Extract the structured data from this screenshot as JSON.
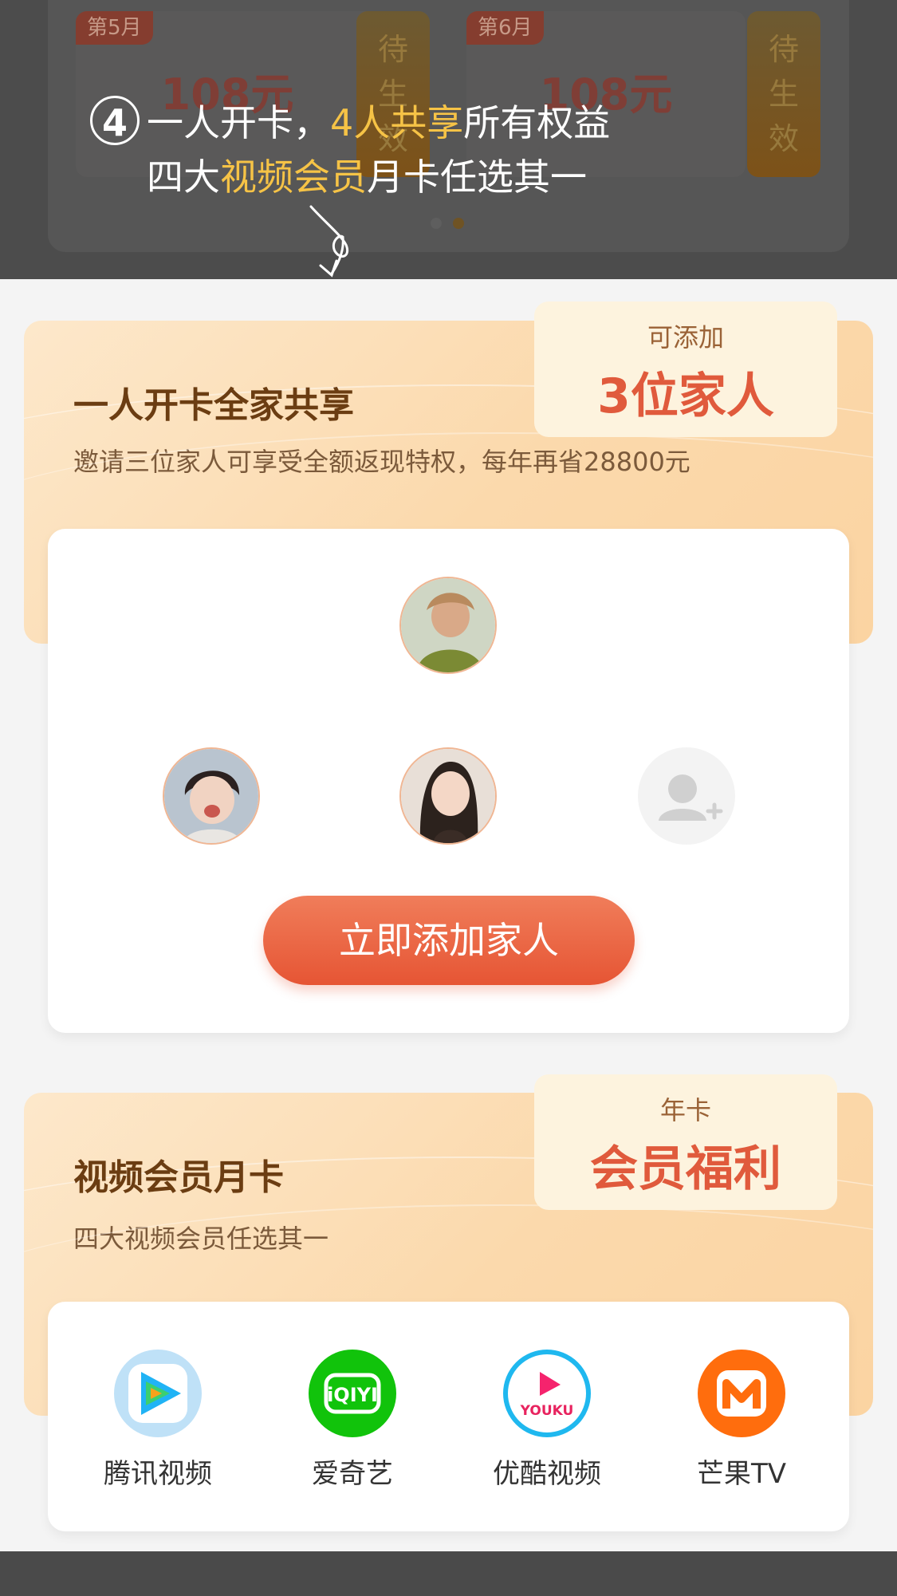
{
  "tip": {
    "number": "4",
    "line1_a": "一人开卡，",
    "line1_hl": "4人共享",
    "line1_b": "所有权益",
    "line2_a": "四大",
    "line2_hl": "视频会员",
    "line2_b": "月卡任选其一"
  },
  "months": [
    {
      "tag": "第5月",
      "amount": "108元",
      "status": "待生效"
    },
    {
      "tag": "第6月",
      "amount": "108元",
      "status": "待生效"
    }
  ],
  "family": {
    "title": "一人开卡全家共享",
    "desc": "邀请三位家人可享受全额返现特权，每年再省28800元",
    "badge_sub": "可添加",
    "badge_main": "3位家人",
    "cta": "立即添加家人"
  },
  "video": {
    "title": "视频会员月卡",
    "desc": "四大视频会员任选其一",
    "badge_sub": "年卡",
    "badge_main": "会员福利",
    "apps": [
      {
        "name": "腾讯视频",
        "icon": "tencent-video-icon"
      },
      {
        "name": "爱奇艺",
        "icon": "iqiyi-icon"
      },
      {
        "name": "优酷视频",
        "icon": "youku-icon"
      },
      {
        "name": "芒果TV",
        "icon": "mango-tv-icon"
      }
    ]
  },
  "colors": {
    "accent": "#e65534",
    "highlight": "#f6c346",
    "title": "#6b3d12"
  }
}
